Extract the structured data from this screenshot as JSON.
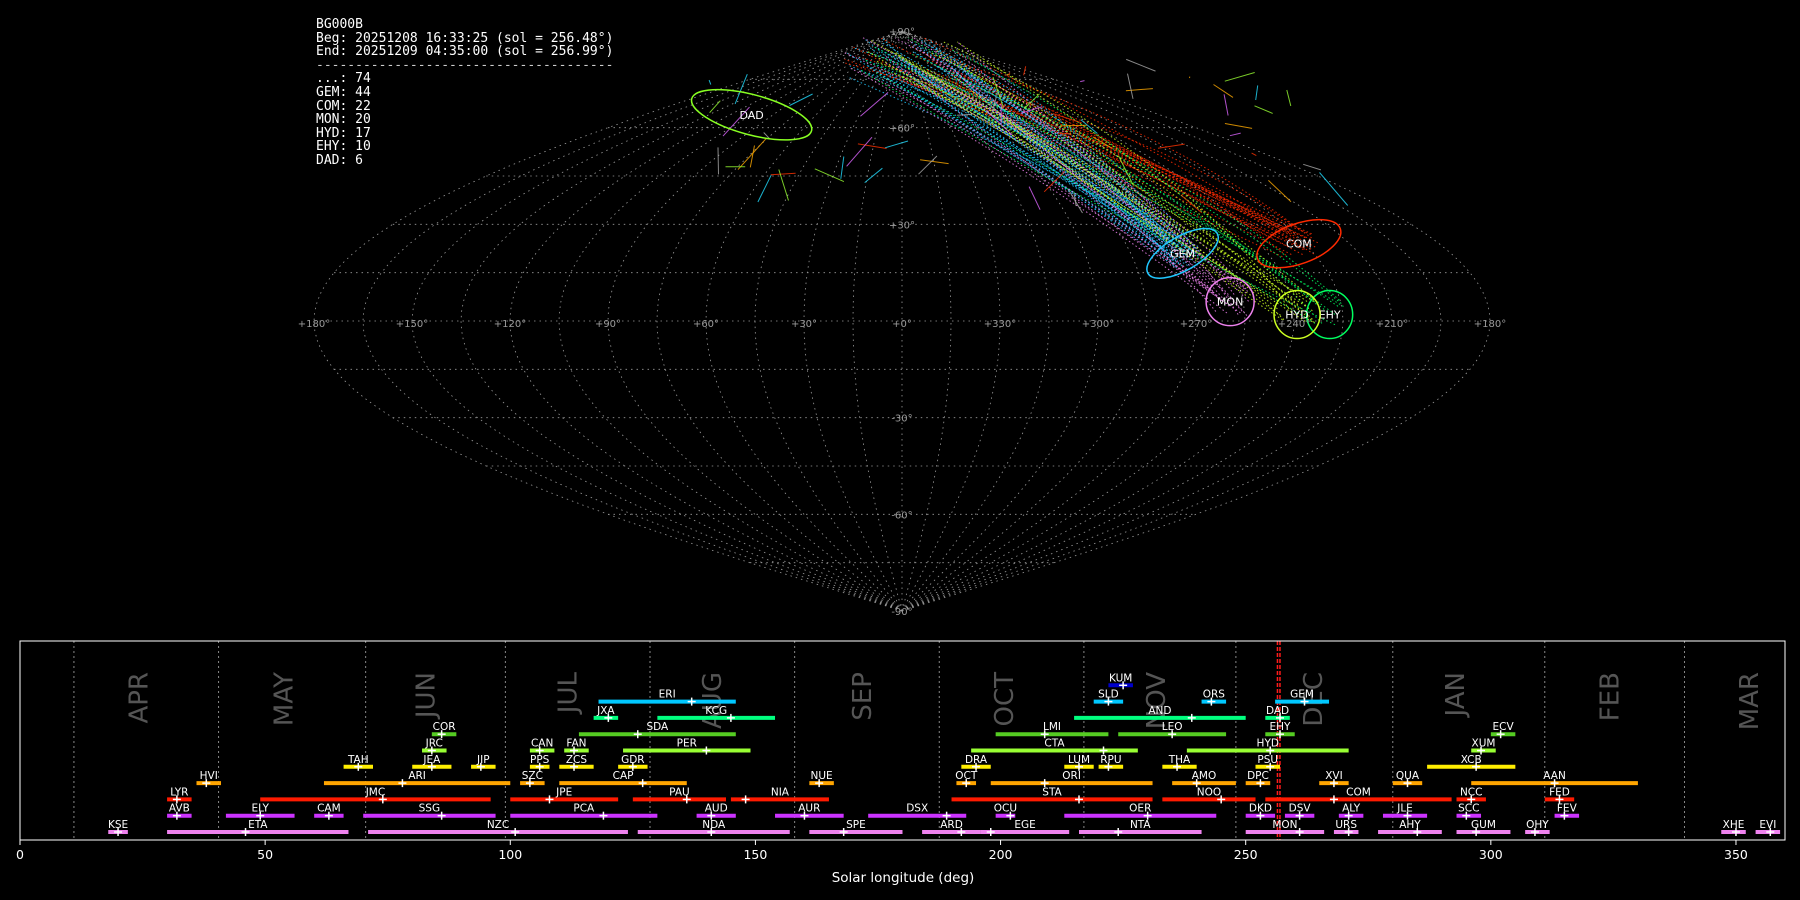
{
  "header": {
    "station": "BG000B",
    "begin": "Beg: 20251208 16:33:25 (sol = 256.48°)",
    "end": "End: 20251209 04:35:00 (sol = 256.99°)",
    "separator": "--------------------------------------"
  },
  "counts": [
    {
      "code": "...",
      "text": "...: 74"
    },
    {
      "code": "GEM",
      "text": "GEM: 44"
    },
    {
      "code": "COM",
      "text": "COM: 22"
    },
    {
      "code": "MON",
      "text": "MON: 20"
    },
    {
      "code": "HYD",
      "text": "HYD: 17"
    },
    {
      "code": "EHY",
      "text": "EHY: 10"
    },
    {
      "code": "DAD",
      "text": "DAD: 6"
    }
  ],
  "chart_data": [
    {
      "type": "scatter",
      "title": "",
      "projection": "sinusoidal",
      "lon_ticks": [
        "+180°",
        "+150°",
        "+120°",
        "+90°",
        "+60°",
        "+30°",
        "+0°",
        "+330°",
        "+300°",
        "+270°",
        "+240°",
        "+210°",
        "+180°"
      ],
      "lat_ticks": [
        "+90°",
        "+60°",
        "+30°",
        "-30°",
        "-60°",
        "-90°"
      ],
      "radiants": [
        {
          "code": "COM",
          "lon": 133,
          "lat": 24,
          "color": "#ff2a00"
        },
        {
          "code": "GEM",
          "lon": 92,
          "lat": 21,
          "color": "#20c8ff"
        },
        {
          "code": "MON",
          "lon": 101,
          "lat": 6,
          "color": "#ee82ee"
        },
        {
          "code": "EHY",
          "lon": 131,
          "lat": 2,
          "color": "#00ff60"
        },
        {
          "code": "HYD",
          "lon": 121,
          "lat": 2,
          "color": "#ccff22"
        },
        {
          "code": "DAD",
          "lon": 255,
          "lat": 64,
          "color": "#88ff22"
        }
      ]
    },
    {
      "type": "bar",
      "title": "",
      "xlabel": "Solar longitude (deg)",
      "xlim": [
        0,
        360
      ],
      "x_ticks": [
        0,
        50,
        100,
        150,
        200,
        250,
        300,
        350
      ],
      "current_sol": [
        256.48,
        256.99
      ],
      "months": [
        {
          "label": "APR",
          "pos": 24.5
        },
        {
          "label": "MAY",
          "pos": 54
        },
        {
          "label": "JUN",
          "pos": 83
        },
        {
          "label": "JUL",
          "pos": 112
        },
        {
          "label": "AUG",
          "pos": 141.5
        },
        {
          "label": "SEP",
          "pos": 172
        },
        {
          "label": "OCT",
          "pos": 201
        },
        {
          "label": "NOV",
          "pos": 232
        },
        {
          "label": "DEC",
          "pos": 264
        },
        {
          "label": "JAN",
          "pos": 293
        },
        {
          "label": "FEB",
          "pos": 324.5
        },
        {
          "label": "MAR",
          "pos": 353
        }
      ],
      "month_boundaries": [
        11,
        40.5,
        70.5,
        99,
        128.5,
        158,
        187.5,
        217,
        248,
        280,
        311,
        339.5
      ],
      "showers": [
        {
          "code": "KUM",
          "row": 9,
          "start": 222,
          "end": 227,
          "peak": 225,
          "color": "#0000cc"
        },
        {
          "code": "ERI",
          "row": 8,
          "start": 118,
          "end": 146,
          "peak": 137,
          "color": "#00c8ff"
        },
        {
          "code": "SLD",
          "row": 8,
          "start": 219,
          "end": 225,
          "peak": 222,
          "color": "#00c8ff"
        },
        {
          "code": "ORS",
          "row": 8,
          "start": 241,
          "end": 246,
          "peak": 243,
          "color": "#00c8ff"
        },
        {
          "code": "GEM",
          "row": 8,
          "start": 256,
          "end": 267,
          "peak": 262,
          "color": "#00c8ff"
        },
        {
          "code": "JXA",
          "row": 7,
          "start": 117,
          "end": 122,
          "peak": 120,
          "color": "#00ff7f"
        },
        {
          "code": "KCG",
          "row": 7,
          "start": 130,
          "end": 154,
          "peak": 145,
          "color": "#00ff7f"
        },
        {
          "code": "AND",
          "row": 7,
          "start": 215,
          "end": 250,
          "peak": 239,
          "color": "#00ff7f"
        },
        {
          "code": "DAD",
          "row": 7,
          "start": 254,
          "end": 259,
          "peak": 257,
          "color": "#00ff7f"
        },
        {
          "code": "COR",
          "row": 6,
          "start": 84,
          "end": 89,
          "peak": 86,
          "color": "#55cc22"
        },
        {
          "code": "SDA",
          "row": 6,
          "start": 114,
          "end": 146,
          "peak": 126,
          "color": "#55cc22"
        },
        {
          "code": "LMI",
          "row": 6,
          "start": 199,
          "end": 222,
          "peak": 209,
          "color": "#55cc22"
        },
        {
          "code": "LEO",
          "row": 6,
          "start": 224,
          "end": 246,
          "peak": 235,
          "color": "#55cc22"
        },
        {
          "code": "EHY",
          "row": 6,
          "start": 254,
          "end": 260,
          "peak": 257,
          "color": "#55cc22"
        },
        {
          "code": "ECV",
          "row": 6,
          "start": 300,
          "end": 305,
          "peak": 302,
          "color": "#55cc22"
        },
        {
          "code": "JRC",
          "row": 5,
          "start": 82,
          "end": 87,
          "peak": 84,
          "color": "#99ff33"
        },
        {
          "code": "CAN",
          "row": 5,
          "start": 104,
          "end": 109,
          "peak": 106,
          "color": "#99ff33"
        },
        {
          "code": "FAN",
          "row": 5,
          "start": 111,
          "end": 116,
          "peak": 113,
          "color": "#99ff33"
        },
        {
          "code": "PER",
          "row": 5,
          "start": 123,
          "end": 149,
          "peak": 140,
          "color": "#99ff33"
        },
        {
          "code": "CTA",
          "row": 5,
          "start": 194,
          "end": 228,
          "peak": 221,
          "color": "#99ff33"
        },
        {
          "code": "HYD",
          "row": 5,
          "start": 238,
          "end": 271,
          "peak": 255,
          "color": "#99ff33"
        },
        {
          "code": "XUM",
          "row": 5,
          "start": 296,
          "end": 301,
          "peak": 298,
          "color": "#99ff33"
        },
        {
          "code": "TAH",
          "row": 4,
          "start": 66,
          "end": 72,
          "peak": 69,
          "color": "#ffee00"
        },
        {
          "code": "JEA",
          "row": 4,
          "start": 80,
          "end": 88,
          "peak": 84,
          "color": "#ffee00"
        },
        {
          "code": "JIP",
          "row": 4,
          "start": 92,
          "end": 97,
          "peak": 94,
          "color": "#ffee00"
        },
        {
          "code": "PPS",
          "row": 4,
          "start": 104,
          "end": 108,
          "peak": 106,
          "color": "#ffee00"
        },
        {
          "code": "ZCS",
          "row": 4,
          "start": 110,
          "end": 117,
          "peak": 113,
          "color": "#ffee00"
        },
        {
          "code": "GDR",
          "row": 4,
          "start": 122,
          "end": 128,
          "peak": 125,
          "color": "#ffee00"
        },
        {
          "code": "DRA",
          "row": 4,
          "start": 192,
          "end": 198,
          "peak": 195,
          "color": "#ffee00"
        },
        {
          "code": "LUM",
          "row": 4,
          "start": 213,
          "end": 219,
          "peak": 216,
          "color": "#ffee00"
        },
        {
          "code": "RPU",
          "row": 4,
          "start": 220,
          "end": 225,
          "peak": 222,
          "color": "#ffee00"
        },
        {
          "code": "THA",
          "row": 4,
          "start": 233,
          "end": 240,
          "peak": 236,
          "color": "#ffee00"
        },
        {
          "code": "PSU",
          "row": 4,
          "start": 252,
          "end": 257,
          "peak": 255,
          "color": "#ffee00"
        },
        {
          "code": "XCB",
          "row": 4,
          "start": 287,
          "end": 305,
          "peak": 297,
          "color": "#ffee00"
        },
        {
          "code": "HVI",
          "row": 3,
          "start": 36,
          "end": 41,
          "peak": 38,
          "color": "#ffa500"
        },
        {
          "code": "ARI",
          "row": 3,
          "start": 62,
          "end": 100,
          "peak": 78,
          "color": "#ffa500"
        },
        {
          "code": "SZC",
          "row": 3,
          "start": 102,
          "end": 107,
          "peak": 104,
          "color": "#ffa500"
        },
        {
          "code": "CAP",
          "row": 3,
          "start": 110,
          "end": 136,
          "peak": 127,
          "color": "#ffa500"
        },
        {
          "code": "NUE",
          "row": 3,
          "start": 161,
          "end": 166,
          "peak": 163,
          "color": "#ffa500"
        },
        {
          "code": "OCT",
          "row": 3,
          "start": 191,
          "end": 195,
          "peak": 193,
          "color": "#ffa500"
        },
        {
          "code": "ORI",
          "row": 3,
          "start": 198,
          "end": 231,
          "peak": 209,
          "color": "#ffa500"
        },
        {
          "code": "AMO",
          "row": 3,
          "start": 235,
          "end": 248,
          "peak": 240,
          "color": "#ffa500"
        },
        {
          "code": "DPC",
          "row": 3,
          "start": 250,
          "end": 255,
          "peak": 253,
          "color": "#ffa500"
        },
        {
          "code": "XVI",
          "row": 3,
          "start": 265,
          "end": 271,
          "peak": 268,
          "color": "#ffa500"
        },
        {
          "code": "QUA",
          "row": 3,
          "start": 280,
          "end": 286,
          "peak": 283,
          "color": "#ffa500"
        },
        {
          "code": "AAN",
          "row": 3,
          "start": 296,
          "end": 330,
          "peak": 313,
          "color": "#ffa500"
        },
        {
          "code": "LYR",
          "row": 2,
          "start": 30,
          "end": 35,
          "peak": 32,
          "color": "#ff1a00"
        },
        {
          "code": "JMC",
          "row": 2,
          "start": 49,
          "end": 96,
          "peak": 74,
          "color": "#ff1a00"
        },
        {
          "code": "JPE",
          "row": 2,
          "start": 100,
          "end": 122,
          "peak": 108,
          "color": "#ff1a00"
        },
        {
          "code": "PAU",
          "row": 2,
          "start": 125,
          "end": 144,
          "peak": 136,
          "color": "#ff1a00"
        },
        {
          "code": "NIA",
          "row": 2,
          "start": 145,
          "end": 165,
          "peak": 148,
          "color": "#ff1a00"
        },
        {
          "code": "STA",
          "row": 2,
          "start": 190,
          "end": 231,
          "peak": 216,
          "color": "#ff1a00"
        },
        {
          "code": "NOO",
          "row": 2,
          "start": 233,
          "end": 252,
          "peak": 245,
          "color": "#ff1a00"
        },
        {
          "code": "COM",
          "row": 2,
          "start": 254,
          "end": 292,
          "peak": 268,
          "color": "#ff1a00"
        },
        {
          "code": "NCC",
          "row": 2,
          "start": 293,
          "end": 299,
          "peak": 296,
          "color": "#ff1a00"
        },
        {
          "code": "FED",
          "row": 2,
          "start": 311,
          "end": 317,
          "peak": 314,
          "color": "#ff1a00"
        },
        {
          "code": "AVB",
          "row": 1,
          "start": 30,
          "end": 35,
          "peak": 32,
          "color": "#cc33ff"
        },
        {
          "code": "ELY",
          "row": 1,
          "start": 42,
          "end": 56,
          "peak": 49,
          "color": "#cc33ff"
        },
        {
          "code": "CAM",
          "row": 1,
          "start": 60,
          "end": 66,
          "peak": 63,
          "color": "#cc33ff"
        },
        {
          "code": "SSG",
          "row": 1,
          "start": 70,
          "end": 97,
          "peak": 86,
          "color": "#cc33ff"
        },
        {
          "code": "PCA",
          "row": 1,
          "start": 100,
          "end": 130,
          "peak": 119,
          "color": "#cc33ff"
        },
        {
          "code": "AUD",
          "row": 1,
          "start": 138,
          "end": 146,
          "peak": 141,
          "color": "#cc33ff"
        },
        {
          "code": "AUR",
          "row": 1,
          "start": 154,
          "end": 168,
          "peak": 160,
          "color": "#cc33ff"
        },
        {
          "code": "DSX",
          "row": 1,
          "start": 173,
          "end": 193,
          "peak": 189,
          "color": "#cc33ff"
        },
        {
          "code": "OCU",
          "row": 1,
          "start": 199,
          "end": 203,
          "peak": 202,
          "color": "#cc33ff"
        },
        {
          "code": "OER",
          "row": 1,
          "start": 213,
          "end": 244,
          "peak": 230,
          "color": "#cc33ff"
        },
        {
          "code": "DKD",
          "row": 1,
          "start": 250,
          "end": 256,
          "peak": 253,
          "color": "#cc33ff"
        },
        {
          "code": "DSV",
          "row": 1,
          "start": 258,
          "end": 264,
          "peak": 261,
          "color": "#cc33ff"
        },
        {
          "code": "ALY",
          "row": 1,
          "start": 269,
          "end": 274,
          "peak": 271,
          "color": "#cc33ff"
        },
        {
          "code": "JLE",
          "row": 1,
          "start": 278,
          "end": 287,
          "peak": 283,
          "color": "#cc33ff"
        },
        {
          "code": "SCC",
          "row": 1,
          "start": 293,
          "end": 298,
          "peak": 295,
          "color": "#cc33ff"
        },
        {
          "code": "FEV",
          "row": 1,
          "start": 313,
          "end": 318,
          "peak": 315,
          "color": "#cc33ff"
        },
        {
          "code": "KSE",
          "row": 0,
          "start": 18,
          "end": 22,
          "peak": 20,
          "color": "#ee82ee"
        },
        {
          "code": "ETA",
          "row": 0,
          "start": 30,
          "end": 67,
          "peak": 46,
          "color": "#ee82ee"
        },
        {
          "code": "NZC",
          "row": 0,
          "start": 71,
          "end": 124,
          "peak": 101,
          "color": "#ee82ee"
        },
        {
          "code": "NDA",
          "row": 0,
          "start": 126,
          "end": 157,
          "peak": 141,
          "color": "#ee82ee"
        },
        {
          "code": "SPE",
          "row": 0,
          "start": 161,
          "end": 180,
          "peak": 168,
          "color": "#ee82ee"
        },
        {
          "code": "ARD",
          "row": 0,
          "start": 184,
          "end": 196,
          "peak": 192,
          "color": "#ee82ee"
        },
        {
          "code": "EGE",
          "row": 0,
          "start": 196,
          "end": 214,
          "peak": 198,
          "color": "#ee82ee"
        },
        {
          "code": "NTA",
          "row": 0,
          "start": 216,
          "end": 241,
          "peak": 224,
          "color": "#ee82ee"
        },
        {
          "code": "MON",
          "row": 0,
          "start": 250,
          "end": 266,
          "peak": 261,
          "color": "#ee82ee"
        },
        {
          "code": "URS",
          "row": 0,
          "start": 268,
          "end": 273,
          "peak": 271,
          "color": "#ee82ee"
        },
        {
          "code": "AHY",
          "row": 0,
          "start": 277,
          "end": 290,
          "peak": 285,
          "color": "#ee82ee"
        },
        {
          "code": "GUM",
          "row": 0,
          "start": 293,
          "end": 304,
          "peak": 297,
          "color": "#ee82ee"
        },
        {
          "code": "OHY",
          "row": 0,
          "start": 307,
          "end": 312,
          "peak": 309,
          "color": "#ee82ee"
        },
        {
          "code": "XHE",
          "row": 0,
          "start": 347,
          "end": 352,
          "peak": 350,
          "color": "#ee82ee"
        },
        {
          "code": "EVI",
          "row": 0,
          "start": 354,
          "end": 359,
          "peak": 357,
          "color": "#ee82ee"
        }
      ]
    }
  ]
}
